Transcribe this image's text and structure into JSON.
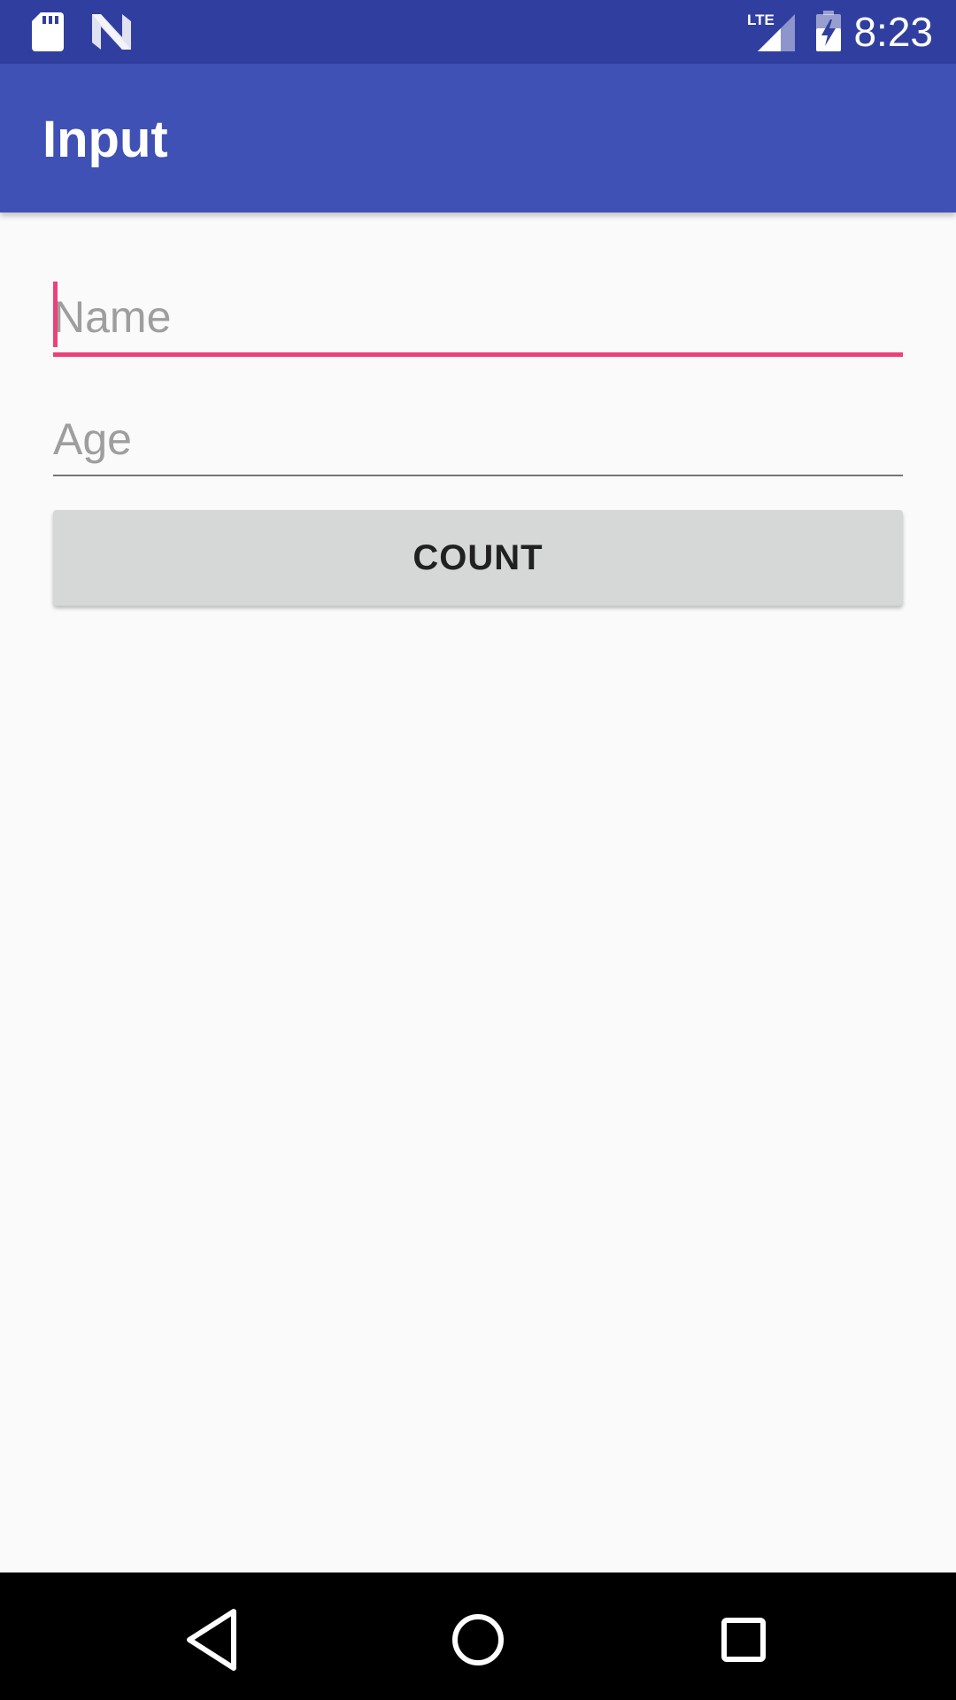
{
  "status_bar": {
    "time": "8:23",
    "network_label": "LTE",
    "icons": [
      "sd-card-icon",
      "n-notification-icon",
      "lte-signal-icon",
      "battery-charging-icon"
    ]
  },
  "app_bar": {
    "title": "Input"
  },
  "form": {
    "name": {
      "value": "",
      "placeholder": "Name",
      "focused": true
    },
    "age": {
      "value": "",
      "placeholder": "Age",
      "focused": false
    },
    "count_button_label": "COUNT"
  },
  "nav_bar": {
    "buttons": [
      "back-icon",
      "home-icon",
      "recents-icon"
    ]
  },
  "colors": {
    "status_bar": "#303f9f",
    "app_bar": "#3f51b5",
    "accent": "#ec407a",
    "background": "#fafafa",
    "button": "#d6d7d7"
  }
}
